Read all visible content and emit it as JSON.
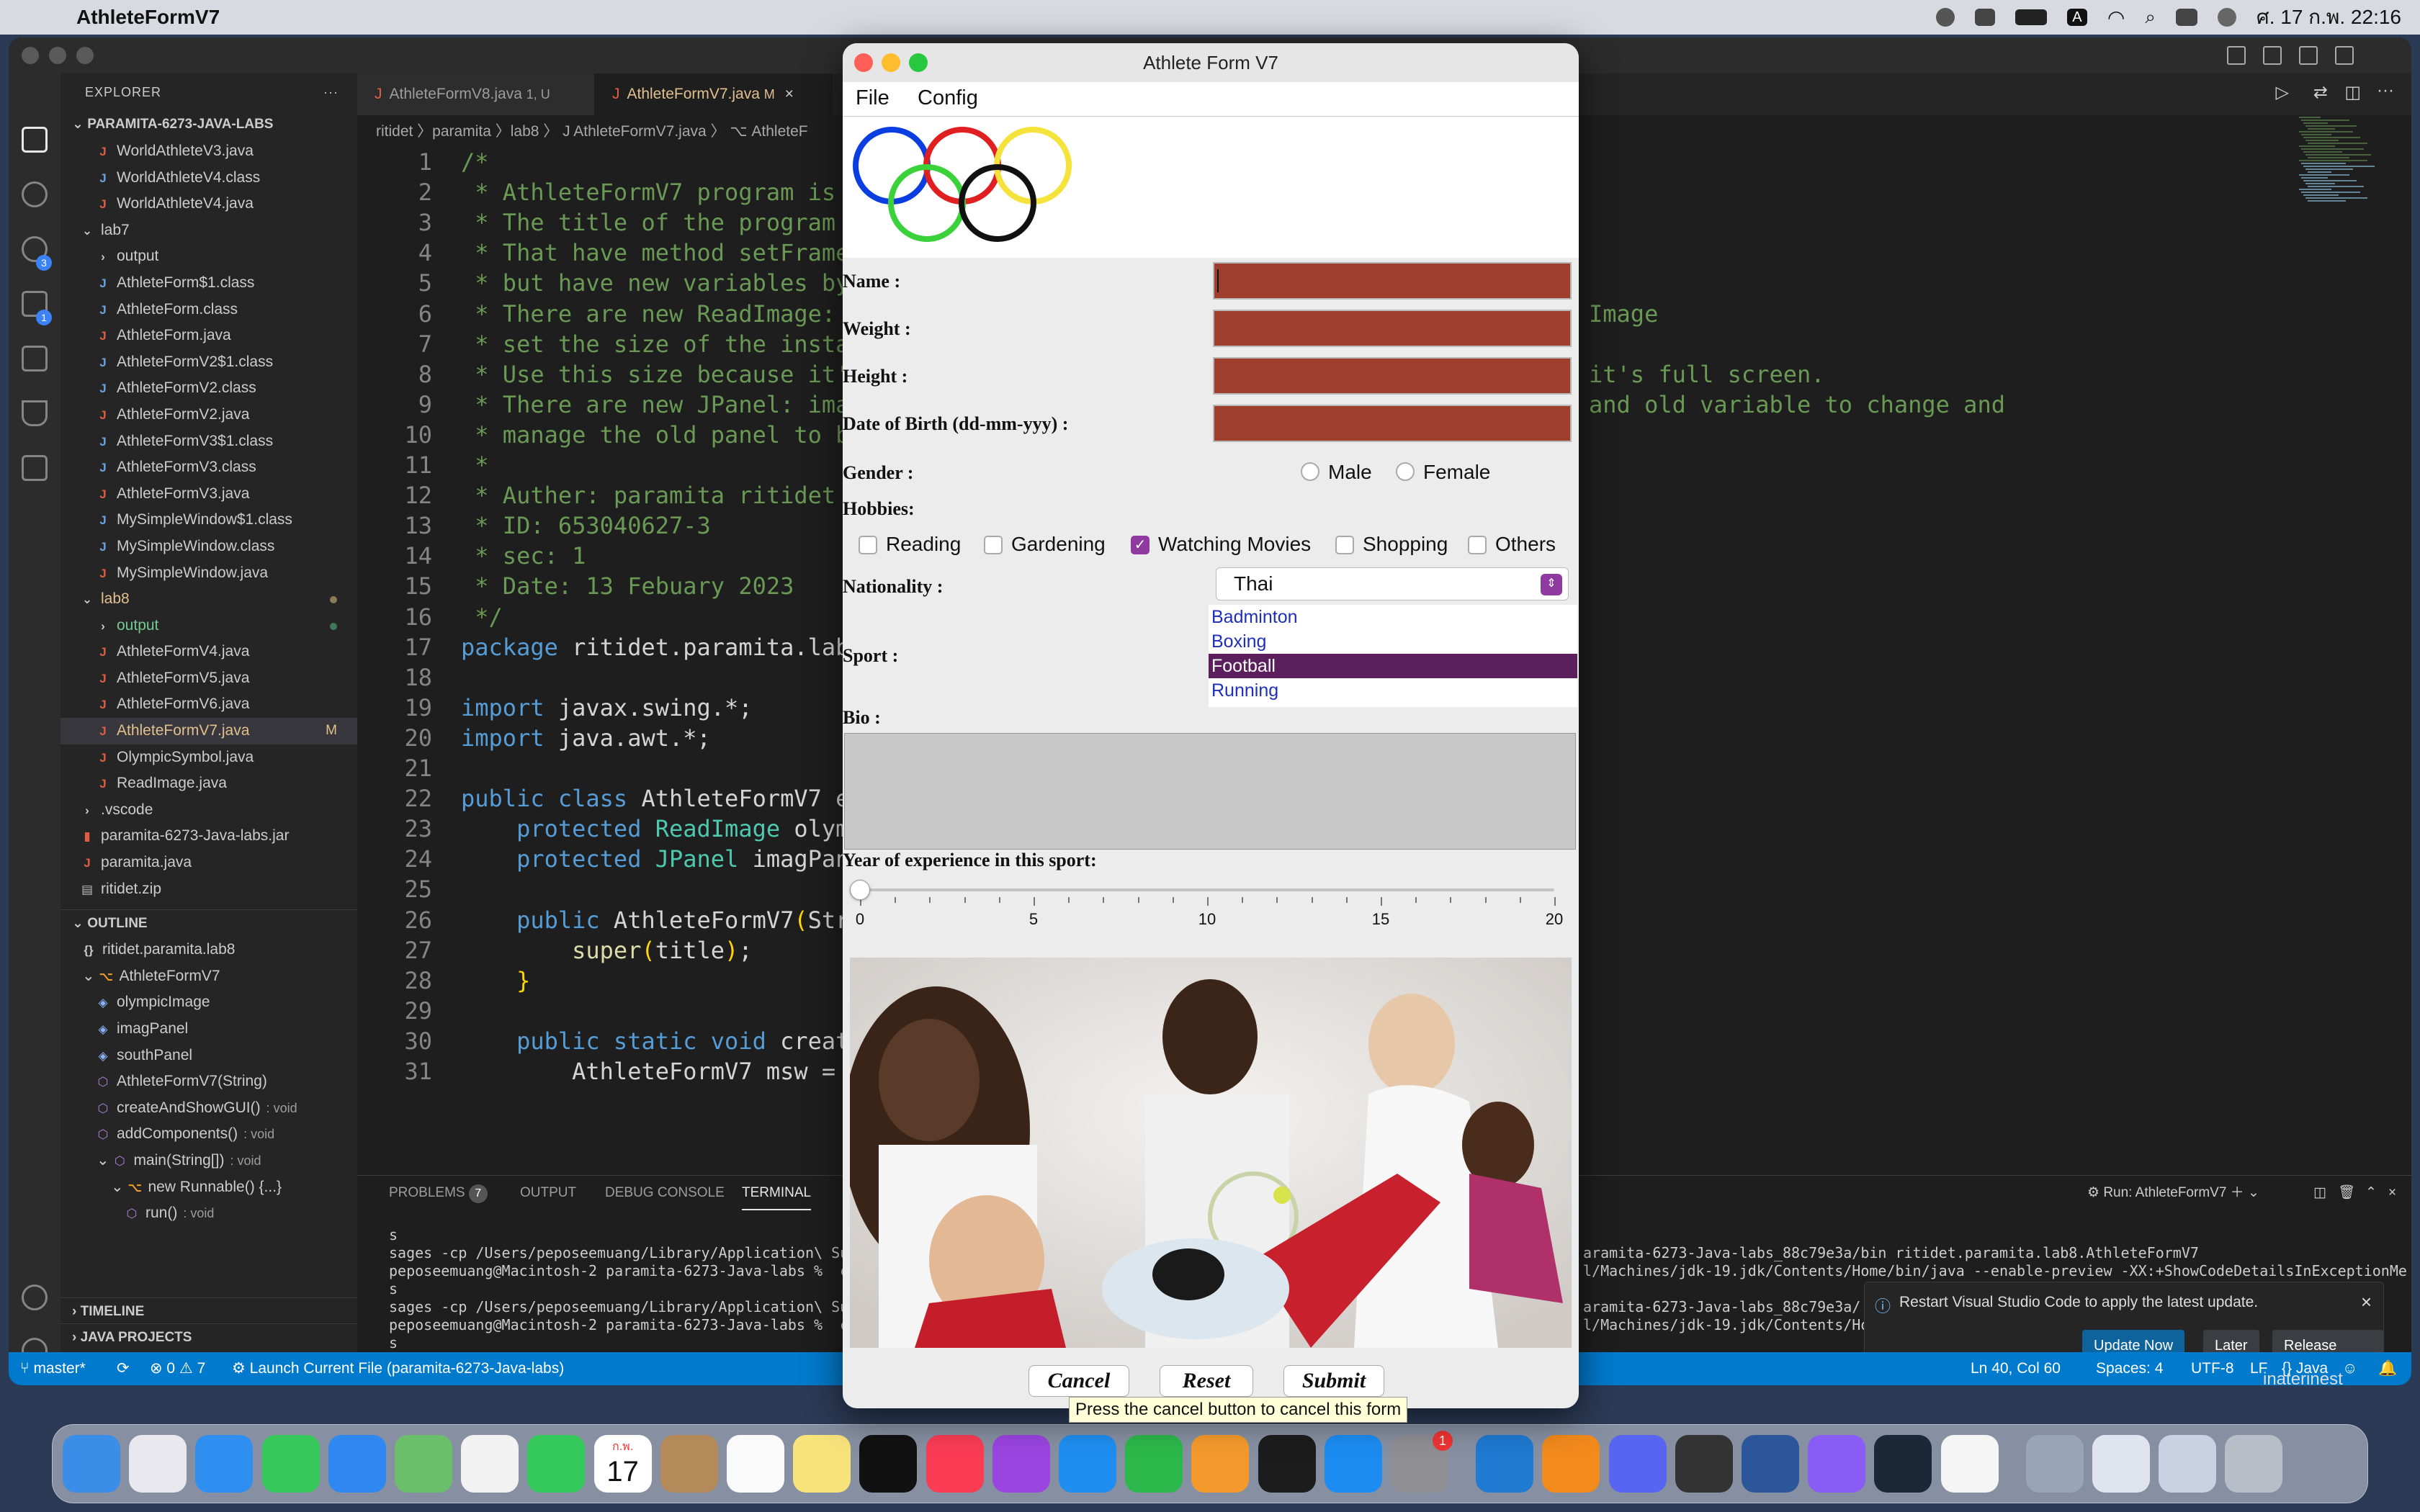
{
  "menubar": {
    "app_name": "AthleteFormV7",
    "clock": "ศ. 17 ก.พ.  22:16",
    "input_lang": "A"
  },
  "activity": {
    "scm_badge": "3",
    "debug_badge": "1",
    "accounts_badge": "1"
  },
  "sidebar": {
    "explorer_title": "EXPLORER",
    "project": "PARAMITA-6273-JAVA-LABS",
    "items": [
      {
        "label": "WorldAthleteV3.java",
        "kind": "java",
        "indent": 2
      },
      {
        "label": "WorldAthleteV4.class",
        "kind": "class",
        "indent": 2
      },
      {
        "label": "WorldAthleteV4.java",
        "kind": "java",
        "indent": 2
      },
      {
        "label": "lab7",
        "kind": "folder-open",
        "indent": 1
      },
      {
        "label": "output",
        "kind": "folder",
        "indent": 2
      },
      {
        "label": "AthleteForm$1.class",
        "kind": "class",
        "indent": 2
      },
      {
        "label": "AthleteForm.class",
        "kind": "class",
        "indent": 2
      },
      {
        "label": "AthleteForm.java",
        "kind": "java",
        "indent": 2
      },
      {
        "label": "AthleteFormV2$1.class",
        "kind": "class",
        "indent": 2
      },
      {
        "label": "AthleteFormV2.class",
        "kind": "class",
        "indent": 2
      },
      {
        "label": "AthleteFormV2.java",
        "kind": "java",
        "indent": 2
      },
      {
        "label": "AthleteFormV3$1.class",
        "kind": "class",
        "indent": 2
      },
      {
        "label": "AthleteFormV3.class",
        "kind": "class",
        "indent": 2
      },
      {
        "label": "AthleteFormV3.java",
        "kind": "java",
        "indent": 2
      },
      {
        "label": "MySimpleWindow$1.class",
        "kind": "class",
        "indent": 2
      },
      {
        "label": "MySimpleWindow.class",
        "kind": "class",
        "indent": 2
      },
      {
        "label": "MySimpleWindow.java",
        "kind": "java",
        "indent": 2
      },
      {
        "label": "lab8",
        "kind": "folder-open",
        "indent": 1,
        "color": "#e2c08d",
        "dot": "#8a7a55"
      },
      {
        "label": "output",
        "kind": "folder",
        "indent": 2,
        "color": "#73c991",
        "dot": "#3f7a55"
      },
      {
        "label": "AthleteFormV4.java",
        "kind": "java",
        "indent": 2
      },
      {
        "label": "AthleteFormV5.java",
        "kind": "java",
        "indent": 2
      },
      {
        "label": "AthleteFormV6.java",
        "kind": "java",
        "indent": 2
      },
      {
        "label": "AthleteFormV7.java",
        "kind": "java",
        "indent": 2,
        "selected": true,
        "mark": "M"
      },
      {
        "label": "OlympicSymbol.java",
        "kind": "java",
        "indent": 2
      },
      {
        "label": "ReadImage.java",
        "kind": "java",
        "indent": 2
      },
      {
        "label": ".vscode",
        "kind": "folder",
        "indent": 1
      },
      {
        "label": "paramita-6273-Java-labs.jar",
        "kind": "jar",
        "indent": 1
      },
      {
        "label": "paramita.java",
        "kind": "java",
        "indent": 1
      },
      {
        "label": "ritidet.zip",
        "kind": "zip",
        "indent": 1
      }
    ],
    "outline_title": "OUTLINE",
    "outline": [
      {
        "label": "ritidet.paramita.lab8",
        "icon": "{}",
        "indent": 1
      },
      {
        "label": "AthleteFormV7",
        "icon": "⌥",
        "indent": 1,
        "open": true
      },
      {
        "label": "olympicImage",
        "icon": "◈",
        "indent": 2
      },
      {
        "label": "imagPanel",
        "icon": "◈",
        "indent": 2
      },
      {
        "label": "southPanel",
        "icon": "◈",
        "indent": 2
      },
      {
        "label": "AthleteFormV7(String)",
        "icon": "⬡",
        "indent": 2
      },
      {
        "label": "createAndShowGUI()",
        "icon": "⬡",
        "indent": 2,
        "sub": ": void"
      },
      {
        "label": "addComponents()",
        "icon": "⬡",
        "indent": 2,
        "sub": ": void"
      },
      {
        "label": "main(String[])",
        "icon": "⬡",
        "indent": 2,
        "sub": ": void",
        "open": true
      },
      {
        "label": "new Runnable() {...}",
        "icon": "⌥",
        "indent": 3,
        "open": true
      },
      {
        "label": "run()",
        "icon": "⬡",
        "indent": 4,
        "sub": ": void"
      }
    ],
    "timeline": "TIMELINE",
    "java_projects": "JAVA PROJECTS"
  },
  "editor": {
    "tabs": [
      {
        "label": "AthleteFormV8.java",
        "status": "1, U"
      },
      {
        "label": "AthleteFormV7.java",
        "status": "M"
      }
    ],
    "breadcrumb": "ritidet 〉paramita 〉lab8 〉 J  AthleteFormV7.java 〉 ⌥ AthleteF",
    "lines": [
      "/*",
      " * AthleteFormV7 program is pa",
      " * The title of the program is",
      " * That have method setFrameFe",
      " * but have new variables by a",
      " * There are new ReadImage: o",
      " * set the size of the instanc",
      " * Use this size because it's",
      " * There are new JPanel: imagP",
      " * manage the old panel to be",
      " *",
      " * Auther: paramita ritidet",
      " * ID: 653040627-3",
      " * sec: 1",
      " * Date: 13 Febuary 2023",
      " */",
      "package ritidet.paramita.lab8;",
      "",
      "import javax.swing.*;",
      "import java.awt.*;",
      "",
      "public class AthleteFormV7 ext",
      "    protected ReadImage olympi",
      "    protected JPanel imagPanel",
      "",
      "    public AthleteFormV7(Strin",
      "        super(title);",
      "    }",
      "",
      "    public static void createA",
      "        AthleteFormV7 msw = ne"
    ],
    "right_fragments": [
      {
        "line": 6,
        "text": "Image"
      },
      {
        "line": 8,
        "text": "it's full screen."
      },
      {
        "line": 9,
        "text": "and old variable to change and"
      }
    ]
  },
  "panel": {
    "tabs": [
      "PROBLEMS",
      "OUTPUT",
      "DEBUG CONSOLE",
      "TERMINAL"
    ],
    "problems_count": "7",
    "run_label": "Run: AthleteFormV7",
    "terminal_left": [
      "s",
      "sages -cp /Users/peposeemuang/Library/Application\\ Su",
      "peposeemuang@Macintosh-2 paramita-6273-Java-labs %  c",
      "s",
      "sages -cp /Users/peposeemuang/Library/Application\\ Su",
      "peposeemuang@Macintosh-2 paramita-6273-Java-labs %  c",
      "s",
      "sages -cp /Users/peposeemuang/Library/Application\\ Su"
    ],
    "terminal_right": [
      "",
      "aramita-6273-Java-labs_88c79e3a/bin ritidet.paramita.lab8.AthleteFormV7",
      "l/Machines/jdk-19.jdk/Contents/Home/bin/java --enable-preview -XX:+ShowCodeDetailsInExceptionMe",
      "",
      "aramita-6273-Java-labs_88c79e3a/",
      "l/Machines/jdk-19.jdk/Contents/Hom",
      "",
      "aramita-6273-Java-labs_88c79e3a/"
    ]
  },
  "notification": {
    "message": "Restart Visual Studio Code to apply the latest update.",
    "update": "Update Now",
    "later": "Later",
    "notes": "Release Notes"
  },
  "statusbar": {
    "branch": "master*",
    "problems": "⊗ 0 ⚠ 7",
    "launch": "Launch Current File (paramita-6273-Java-labs)",
    "position": "Ln 40, Col 60",
    "spaces": "Spaces: 4",
    "encoding": "UTF-8",
    "eol": "LF",
    "language": "{} Java"
  },
  "behind_text": "inaterinest",
  "java_window": {
    "title": "Athlete Form V7",
    "menu": [
      "File",
      "Config"
    ],
    "labels": {
      "name": "Name :",
      "weight": "Weight :",
      "height": "Height :",
      "dob": "Date of Birth (dd-mm-yyy) :",
      "gender": "Gender :",
      "hobbies": "Hobbies:",
      "nationality": "Nationality :",
      "sport": "Sport :",
      "bio": "Bio :",
      "experience": "Year of experience in this sport:"
    },
    "gender_options": [
      "Male",
      "Female"
    ],
    "hobbies": [
      {
        "label": "Reading",
        "checked": false
      },
      {
        "label": "Gardening",
        "checked": false
      },
      {
        "label": "Watching Movies",
        "checked": true
      },
      {
        "label": "Shopping",
        "checked": false
      },
      {
        "label": "Others",
        "checked": false
      }
    ],
    "nationality": "Thai",
    "sports": [
      {
        "label": "Badminton",
        "selected": false
      },
      {
        "label": "Boxing",
        "selected": false
      },
      {
        "label": "Football",
        "selected": true
      },
      {
        "label": "Running",
        "selected": false
      }
    ],
    "slider": {
      "min": 0,
      "max": 20,
      "value": 0,
      "ticks": [
        "0",
        "5",
        "10",
        "15",
        "20"
      ]
    },
    "buttons": {
      "cancel": "Cancel",
      "reset": "Reset",
      "submit": "Submit"
    },
    "tooltip": "Press the cancel button to cancel this form",
    "field_color": "#9e3f2d",
    "accent": "#8e3a9e"
  },
  "dock": {
    "calendar_month": "ก.พ.",
    "calendar_day": "17",
    "settings_badge": "1"
  }
}
